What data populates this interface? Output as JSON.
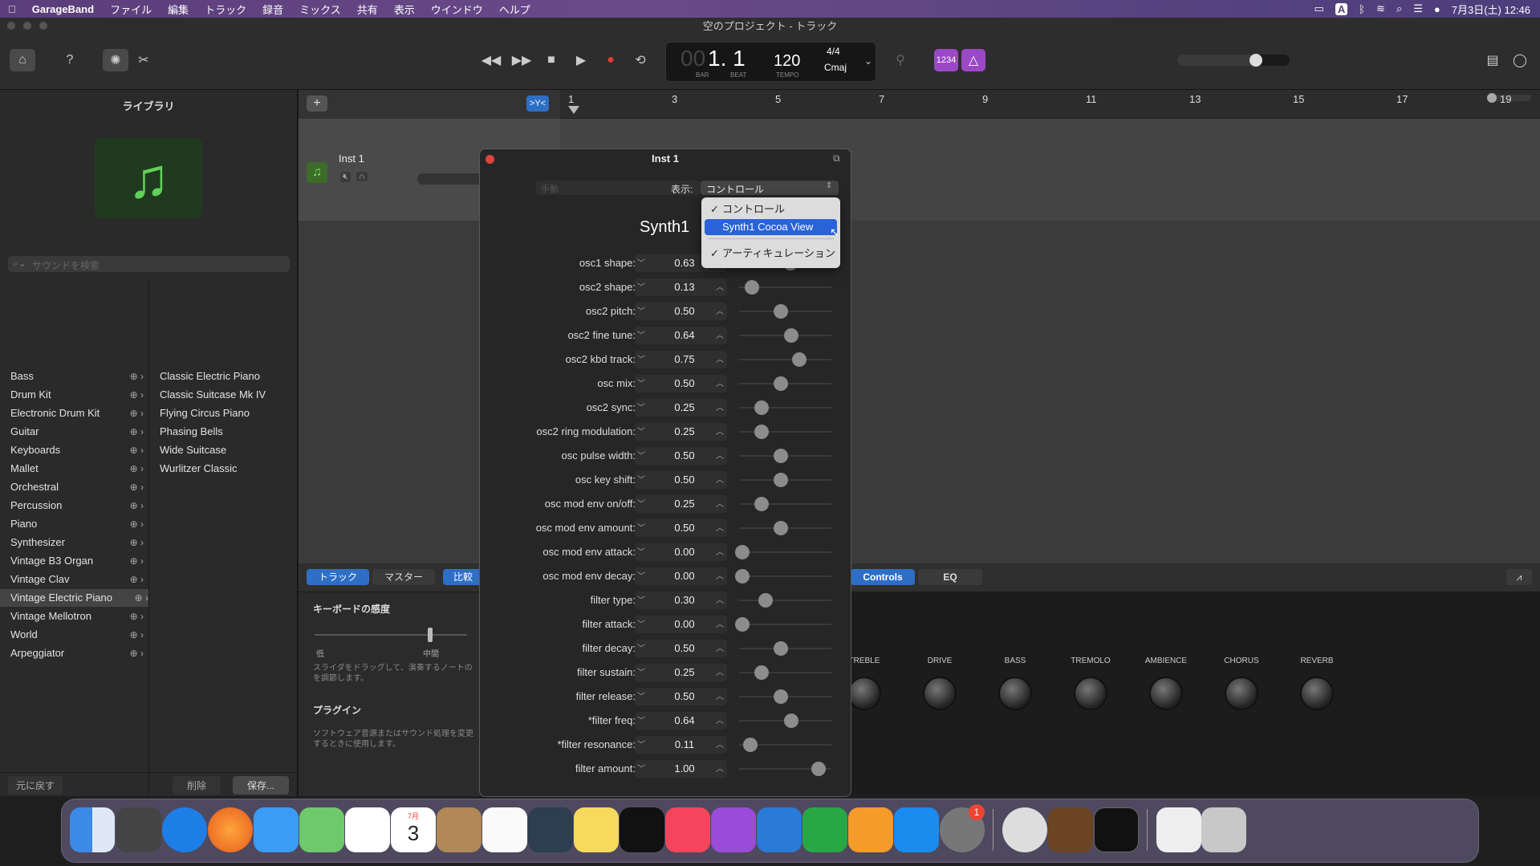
{
  "menubar": {
    "app": "GarageBand",
    "items": [
      "ファイル",
      "編集",
      "トラック",
      "録音",
      "ミックス",
      "共有",
      "表示",
      "ウインドウ",
      "ヘルプ"
    ],
    "clock": "7月3日(土) 12:46"
  },
  "window": {
    "title": "空のプロジェクト - トラック"
  },
  "lcd": {
    "bar": "00",
    "position": "1. 1",
    "bar_label": "BAR",
    "beat_label": "BEAT",
    "tempo": "120",
    "tempo_label": "TEMPO",
    "signature": "4/4",
    "key": "Cmaj"
  },
  "toolbar": {
    "count_in": "1234"
  },
  "library": {
    "title": "ライブラリ",
    "search_placeholder": "サウンドを検索",
    "categories": [
      "Bass",
      "Drum Kit",
      "Electronic Drum Kit",
      "Guitar",
      "Keyboards",
      "Mallet",
      "Orchestral",
      "Percussion",
      "Piano",
      "Synthesizer",
      "Vintage B3 Organ",
      "Vintage Clav",
      "Vintage Electric Piano",
      "Vintage Mellotron",
      "World",
      "Arpeggiator"
    ],
    "patches": [
      "Classic Electric Piano",
      "Classic Suitcase Mk IV",
      "Flying Circus Piano",
      "Phasing Bells",
      "Wide Suitcase",
      "Wurlitzer Classic"
    ],
    "revert": "元に戻す",
    "delete": "削除",
    "save": "保存..."
  },
  "ruler": {
    "marks": [
      "1",
      "3",
      "5",
      "7",
      "9",
      "11",
      "13",
      "15",
      "17",
      "19"
    ]
  },
  "track": {
    "name": "Inst 1"
  },
  "editor": {
    "tabs": [
      "トラック",
      "マスター",
      "比較"
    ],
    "keyboard_sens": "キーボードの感度",
    "low": "低",
    "mid": "中間",
    "slider_hint": "スライダをドラッグして、演奏するノートのを調節します。",
    "plugins": "プラグイン",
    "plugins_hint": "ソフトウェア音源またはサウンド処理を変更するときに使用します。",
    "controls_tab": "Controls",
    "eq_tab": "EQ",
    "knobs": [
      "TREBLE",
      "DRIVE",
      "BASS",
      "TREMOLO",
      "AMBIENCE",
      "CHORUS",
      "REVERB"
    ]
  },
  "plugin": {
    "title": "Inst 1",
    "manual": "手動",
    "view_label": "表示:",
    "view_value": "コントロール",
    "synth": "Synth1",
    "params": [
      {
        "label": "osc1 shape:",
        "value": "0.63",
        "v": 0.63
      },
      {
        "label": "osc2 shape:",
        "value": "0.13",
        "v": 0.13
      },
      {
        "label": "osc2 pitch:",
        "value": "0.50",
        "v": 0.5
      },
      {
        "label": "osc2 fine tune:",
        "value": "0.64",
        "v": 0.64
      },
      {
        "label": "osc2 kbd track:",
        "value": "0.75",
        "v": 0.75
      },
      {
        "label": "osc mix:",
        "value": "0.50",
        "v": 0.5
      },
      {
        "label": "osc2 sync:",
        "value": "0.25",
        "v": 0.25
      },
      {
        "label": "osc2 ring modulation:",
        "value": "0.25",
        "v": 0.25
      },
      {
        "label": "osc pulse width:",
        "value": "0.50",
        "v": 0.5
      },
      {
        "label": "osc key shift:",
        "value": "0.50",
        "v": 0.5
      },
      {
        "label": "osc mod env on/off:",
        "value": "0.25",
        "v": 0.25
      },
      {
        "label": "osc mod env amount:",
        "value": "0.50",
        "v": 0.5
      },
      {
        "label": "osc mod env attack:",
        "value": "0.00",
        "v": 0.0
      },
      {
        "label": "osc mod env decay:",
        "value": "0.00",
        "v": 0.0
      },
      {
        "label": "filter type:",
        "value": "0.30",
        "v": 0.3
      },
      {
        "label": "filter attack:",
        "value": "0.00",
        "v": 0.0
      },
      {
        "label": "filter decay:",
        "value": "0.50",
        "v": 0.5
      },
      {
        "label": "filter sustain:",
        "value": "0.25",
        "v": 0.25
      },
      {
        "label": "filter release:",
        "value": "0.50",
        "v": 0.5
      },
      {
        "label": "*filter freq:",
        "value": "0.64",
        "v": 0.64
      },
      {
        "label": "*filter resonance:",
        "value": "0.11",
        "v": 0.11
      },
      {
        "label": "filter amount:",
        "value": "1.00",
        "v": 1.0
      }
    ]
  },
  "dropdown": {
    "items": [
      "コントロール",
      "Synth1 Cocoa View",
      "アーティキュレーション"
    ]
  },
  "dock": {
    "calendar_month": "7月",
    "calendar_day": "3",
    "badge": "1"
  }
}
